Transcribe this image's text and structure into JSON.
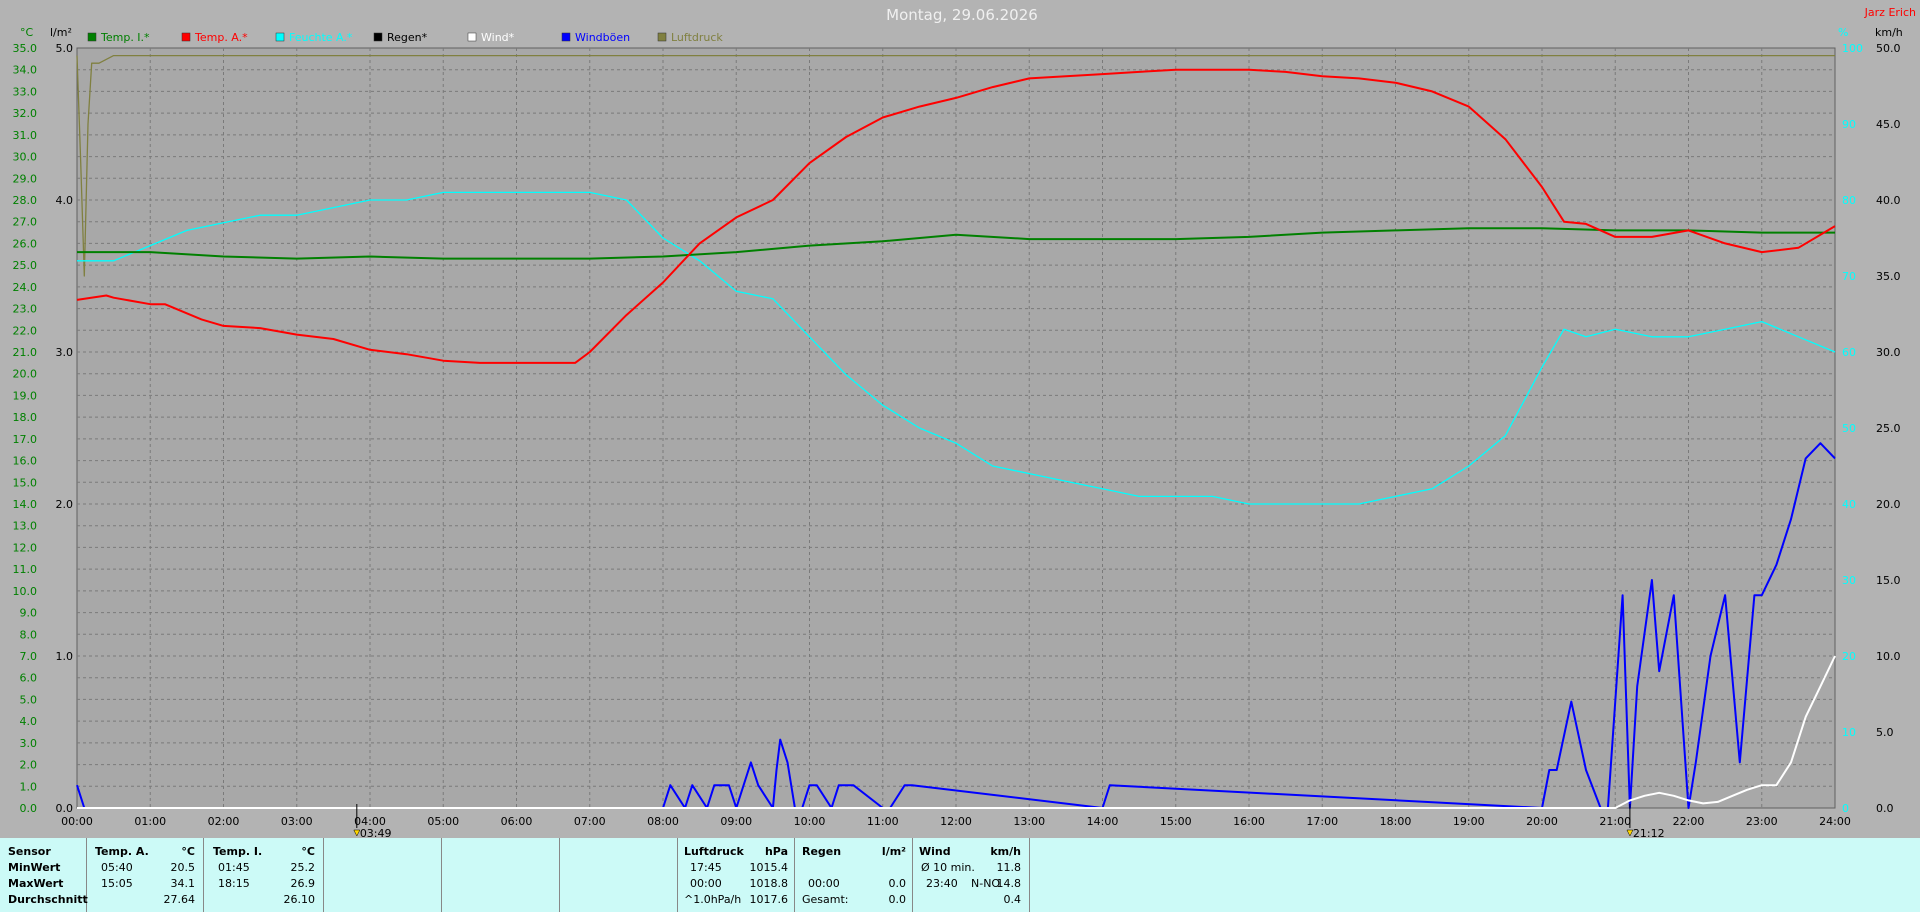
{
  "header": {
    "title": "Montag, 29.06.2026",
    "author": "Jarz Erich",
    "unit_left_temp": "°C",
    "unit_left_rain": "l/m²",
    "unit_right_pct": "%",
    "unit_right_wind": "km/h"
  },
  "legend": [
    {
      "label": "Temp. I.*",
      "color": "#008000"
    },
    {
      "label": "Temp. A.*",
      "color": "#ff0000"
    },
    {
      "label": "Feuchte A.*",
      "color": "#00ffff"
    },
    {
      "label": "Regen*",
      "color": "#000000"
    },
    {
      "label": "Wind*",
      "color": "#ffffff"
    },
    {
      "label": "Windböen",
      "color": "#0000ff"
    },
    {
      "label": "Luftdruck",
      "color": "#808040"
    }
  ],
  "markers": [
    {
      "label": "03:49",
      "hour": 3.82
    },
    {
      "label": "21:12",
      "hour": 21.2
    }
  ],
  "chart_data": {
    "type": "line",
    "title": "Montag, 29.06.2026",
    "x_range_hours": [
      0,
      24
    ],
    "x_ticks": [
      "00:00",
      "01:00",
      "02:00",
      "03:00",
      "04:00",
      "05:00",
      "06:00",
      "07:00",
      "08:00",
      "09:00",
      "10:00",
      "11:00",
      "12:00",
      "13:00",
      "14:00",
      "15:00",
      "16:00",
      "17:00",
      "18:00",
      "19:00",
      "20:00",
      "21:00",
      "22:00",
      "23:00",
      "24:00"
    ],
    "axes": {
      "temp": {
        "unit": "°C",
        "range": [
          0,
          35
        ],
        "ticks": [
          "0.0",
          "1.0",
          "2.0",
          "3.0",
          "4.0",
          "5.0",
          "6.0",
          "7.0",
          "8.0",
          "9.0",
          "10.0",
          "11.0",
          "12.0",
          "13.0",
          "14.0",
          "15.0",
          "16.0",
          "17.0",
          "18.0",
          "19.0",
          "20.0",
          "21.0",
          "22.0",
          "23.0",
          "24.0",
          "25.0",
          "26.0",
          "27.0",
          "28.0",
          "29.0",
          "30.0",
          "31.0",
          "32.0",
          "33.0",
          "34.0",
          "35.0"
        ]
      },
      "rain": {
        "unit": "l/m²",
        "range": [
          0,
          5
        ],
        "ticks": [
          "0.0",
          "1.0",
          "2.0",
          "3.0",
          "4.0",
          "5.0"
        ]
      },
      "humidity": {
        "unit": "%",
        "range": [
          0,
          100
        ],
        "ticks": [
          "0",
          "10",
          "20",
          "30",
          "40",
          "50",
          "60",
          "70",
          "80",
          "90",
          "100"
        ]
      },
      "wind": {
        "unit": "km/h",
        "range": [
          0,
          50
        ],
        "ticks": [
          "0.0",
          "5.0",
          "10.0",
          "15.0",
          "20.0",
          "25.0",
          "30.0",
          "35.0",
          "40.0",
          "45.0",
          "50.0"
        ]
      }
    },
    "grid": true,
    "series": [
      {
        "name": "Temp. I.*",
        "axis": "temp",
        "color": "#008000",
        "x": [
          0,
          1,
          2,
          3,
          4,
          5,
          6,
          7,
          8,
          9,
          10,
          11,
          12,
          13,
          14,
          15,
          16,
          17,
          18,
          19,
          20,
          21,
          22,
          23,
          24
        ],
        "y": [
          25.6,
          25.6,
          25.4,
          25.3,
          25.4,
          25.3,
          25.3,
          25.3,
          25.4,
          25.6,
          25.9,
          26.1,
          26.4,
          26.2,
          26.2,
          26.2,
          26.3,
          26.5,
          26.6,
          26.7,
          26.7,
          26.6,
          26.6,
          26.5,
          26.5
        ]
      },
      {
        "name": "Temp. A.*",
        "axis": "temp",
        "color": "#ff0000",
        "x": [
          0,
          0.4,
          0.5,
          1,
          1.2,
          1.7,
          2,
          2.5,
          3,
          3.5,
          4,
          4.5,
          5,
          5.5,
          5.7,
          6,
          6.5,
          6.8,
          7,
          7.5,
          8,
          8.5,
          9,
          9.5,
          10,
          10.5,
          11,
          11.5,
          12,
          12.5,
          13,
          13.5,
          14,
          14.5,
          15,
          15.5,
          16,
          16.5,
          17,
          17.5,
          18,
          18.5,
          19,
          19.5,
          20,
          20.3,
          20.6,
          21,
          21.5,
          22,
          22.5,
          23,
          23.5,
          24
        ],
        "y": [
          23.4,
          23.6,
          23.5,
          23.2,
          23.2,
          22.5,
          22.2,
          22.1,
          21.8,
          21.6,
          21.1,
          20.9,
          20.6,
          20.5,
          20.5,
          20.5,
          20.5,
          20.5,
          21.0,
          22.7,
          24.2,
          26.0,
          27.2,
          28.0,
          29.7,
          30.9,
          31.8,
          32.3,
          32.7,
          33.2,
          33.6,
          33.7,
          33.8,
          33.9,
          34.0,
          34.0,
          34.0,
          33.9,
          33.7,
          33.6,
          33.4,
          33.0,
          32.3,
          30.8,
          28.6,
          27.0,
          26.9,
          26.3,
          26.3,
          26.6,
          26.0,
          25.6,
          25.8,
          26.8
        ]
      },
      {
        "name": "Feuchte A.*",
        "axis": "humidity",
        "color": "#00ffff",
        "x": [
          0,
          0.5,
          1,
          1.5,
          2,
          2.5,
          3,
          3.5,
          4,
          4.5,
          5,
          5.5,
          6,
          6.5,
          7,
          7.5,
          8,
          8.5,
          9,
          9.5,
          10,
          10.5,
          11,
          11.5,
          12,
          12.5,
          13,
          13.5,
          14,
          14.5,
          15,
          15.5,
          16,
          16.5,
          17,
          17.5,
          18,
          18.5,
          19,
          19.5,
          20,
          20.3,
          20.6,
          21,
          21.5,
          22,
          22.5,
          23,
          23.5,
          24
        ],
        "y": [
          72,
          72,
          74,
          76,
          77,
          78,
          78,
          79,
          80,
          80,
          81,
          81,
          81,
          81,
          81,
          80,
          75,
          72,
          68,
          67,
          62,
          57,
          53,
          50,
          48,
          45,
          44,
          43,
          42,
          41,
          41,
          41,
          40,
          40,
          40,
          40,
          41,
          42,
          45,
          49,
          58,
          63,
          62,
          63,
          62,
          62,
          63,
          64,
          62,
          60
        ]
      },
      {
        "name": "Windböen",
        "axis": "wind",
        "color": "#0000ff",
        "x": [
          0,
          0.1,
          8,
          8.1,
          8.3,
          8.4,
          8.6,
          8.7,
          8.9,
          9,
          9.2,
          9.3,
          9.5,
          9.55,
          9.6,
          9.7,
          9.8,
          9.9,
          10,
          10.1,
          10.3,
          10.4,
          10.6,
          11,
          11.1,
          11.3,
          11.4,
          14,
          14.1,
          20,
          20.1,
          20.2,
          20.4,
          20.6,
          20.8,
          20.9,
          21.1,
          21.2,
          21.3,
          21.5,
          21.6,
          21.8,
          22,
          22.1,
          22.3,
          22.5,
          22.7,
          22.9,
          23,
          23.2,
          23.4,
          23.6,
          23.8,
          24
        ],
        "y": [
          1.5,
          0,
          0,
          1.5,
          0,
          1.5,
          0,
          1.5,
          1.5,
          0,
          3,
          1.5,
          0,
          2.5,
          4.5,
          3,
          0,
          0,
          1.5,
          1.5,
          0,
          1.5,
          1.5,
          0,
          0,
          1.5,
          1.5,
          0,
          1.5,
          0,
          2.5,
          2.5,
          7,
          2.5,
          0,
          0,
          14,
          0,
          8,
          15,
          9,
          14,
          0,
          3,
          10,
          14,
          3,
          14,
          14,
          16,
          19,
          23,
          24,
          23
        ]
      },
      {
        "name": "Wind*",
        "axis": "wind",
        "color": "#ffffff",
        "x": [
          0,
          20,
          21,
          21.2,
          21.4,
          21.6,
          21.8,
          22,
          22.2,
          22.4,
          22.6,
          22.8,
          23,
          23.2,
          23.4,
          23.6,
          23.8,
          24
        ],
        "y": [
          0,
          0,
          0,
          0.5,
          0.8,
          1.0,
          0.8,
          0.5,
          0.3,
          0.4,
          0.8,
          1.2,
          1.5,
          1.5,
          3,
          6,
          8,
          10
        ]
      },
      {
        "name": "Luftdruck",
        "axis": "humidity",
        "color": "#808040",
        "x": [
          0,
          0.05,
          0.1,
          0.15,
          0.2,
          0.3,
          0.5,
          1,
          2,
          3,
          4,
          5,
          6,
          7,
          8,
          9,
          10,
          11,
          12,
          13,
          14,
          15,
          16,
          17,
          18,
          19,
          20,
          21,
          22,
          23,
          24
        ],
        "y": [
          99,
          85,
          70,
          90,
          98,
          98,
          99,
          99,
          99,
          99,
          99,
          99,
          99,
          99,
          99,
          99,
          99,
          99,
          99,
          99,
          99,
          99,
          99,
          99,
          99,
          99,
          99,
          99,
          99,
          99,
          99
        ]
      }
    ]
  },
  "stats": {
    "sensor": {
      "header": "Sensor",
      "rows": [
        "MinWert",
        "MaxWert",
        "Durchschnitt"
      ]
    },
    "temp_a": {
      "header": "Temp. A.",
      "unit": "°C",
      "min_time": "05:40",
      "min_val": "20.5",
      "max_time": "15:05",
      "max_val": "34.1",
      "avg": "27.64"
    },
    "temp_i": {
      "header": "Temp. I.",
      "unit": "°C",
      "min_time": "01:45",
      "min_val": "25.2",
      "max_time": "18:15",
      "max_val": "26.9",
      "avg": "26.10"
    },
    "pressure": {
      "header": "Luftdruck",
      "unit": "hPa",
      "min_time": "17:45",
      "min_val": "1015.4",
      "max_time": "00:00",
      "max_val": "1018.8",
      "trend_label": "^1.0hPa/h",
      "trend_val": "1017.6"
    },
    "rain": {
      "header": "Regen",
      "unit": "l/m²",
      "max_time": "00:00",
      "max_val": "0.0",
      "total_label": "Gesamt:",
      "total_val": "0.0"
    },
    "wind": {
      "header": "Wind",
      "unit": "km/h",
      "avg_label": "Ø 10 min.",
      "avg_val": "11.8",
      "max_time": "23:40",
      "max_dir": "N-NO",
      "max_val": "14.8",
      "day_val": "0.4"
    }
  }
}
